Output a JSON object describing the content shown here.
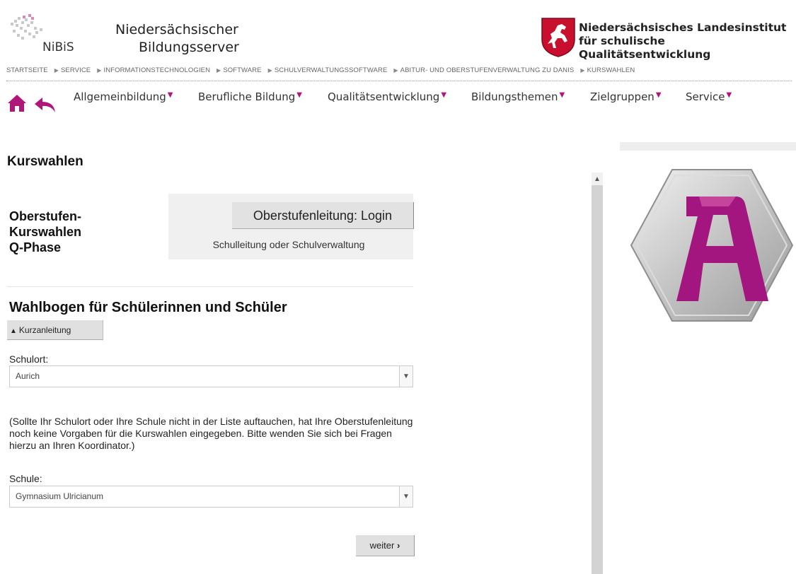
{
  "header": {
    "nibis_logo_text": "NiBiS",
    "site_title_line1": "Niedersächsischer",
    "site_title_line2": "Bildungsserver",
    "nlq_title_line1": "Niedersächsisches Landesinstitut",
    "nlq_title_line2": "für schulische Qualitätsentwicklung"
  },
  "breadcrumb": [
    "STARTSEITE",
    "SERVICE",
    "INFORMATIONSTECHNOLOGIEN",
    "SOFTWARE",
    "SCHULVERWALTUNGSSOFTWARE",
    "ABITUR- UND OBERSTUFENVERWALTUNG ZU DANIS",
    "KURSWAHLEN"
  ],
  "nav": {
    "items": [
      "Allgemeinbildung",
      "Berufliche Bildung",
      "Qualitätsentwicklung",
      "Bildungsthemen",
      "Zielgruppen",
      "Service"
    ],
    "accent": "#b0167a"
  },
  "main": {
    "page_title": "Kurswahlen",
    "oberstufen_title": [
      "Oberstufen-",
      "Kurswahlen",
      "Q-Phase"
    ],
    "login_button": "Oberstufenleitung: Login",
    "login_subtext": "Schulleitung oder Schulverwaltung",
    "wahlbogen_heading": "Wahlbogen für Schülerinnen und Schüler",
    "kurzanleitung_button": "Kurzanleitung",
    "schulort_label": "Schulort:",
    "schulort_value": "Aurich",
    "note": "(Sollte Ihr Schulort oder Ihre Schule nicht in der Liste auftauchen, hat Ihre Oberstufenleitung noch keine Vorgaben für die Kurswahlen eingegeben. Bitte wenden Sie sich bei Fragen hierzu an Ihren Koordinator.)",
    "schule_label": "Schule:",
    "schule_value": "Gymnasium Ulricianum",
    "weiter_button": "weiter"
  },
  "icons": [
    "home-icon",
    "back-icon",
    "chevron-up-icon",
    "chevron-down-icon",
    "chevron-right-icon",
    "horse-crest-icon",
    "app-logo-icon"
  ]
}
